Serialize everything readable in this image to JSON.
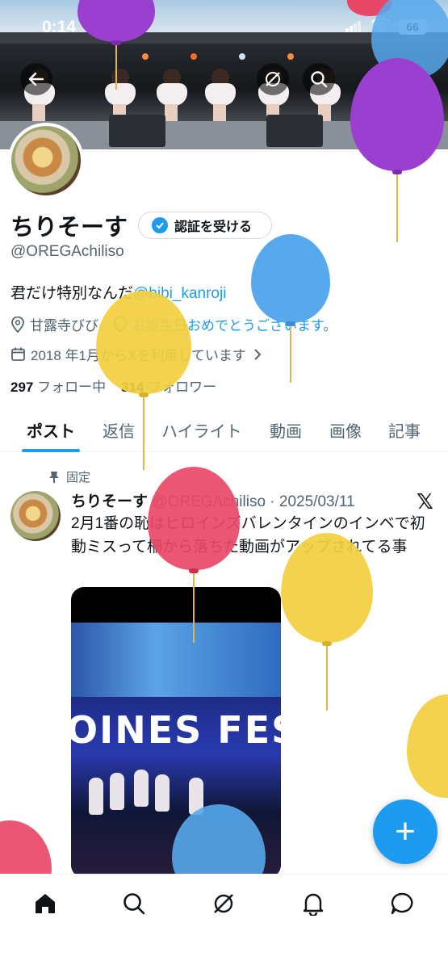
{
  "status_bar": {
    "time": "0:14",
    "battery": "66"
  },
  "profile": {
    "name": "ちりそーす",
    "verify_button": "認証を受ける",
    "handle": "@OREGAchiliso",
    "bio_prefix": "君だけ特別なんだ",
    "bio_mention": "@bibi_kanroji",
    "location": "甘露寺びび",
    "website": "お誕生日おめでとうございます。",
    "joined": "2018 年1月からXを利用しています",
    "following_count": "297",
    "following_label": "フォロー中",
    "followers_count": "314",
    "followers_label": "フォロワー"
  },
  "tabs": [
    "ポスト",
    "返信",
    "ハイライト",
    "動画",
    "画像",
    "記事"
  ],
  "post": {
    "pinned_label": "固定",
    "author": "ちりそーす",
    "handle_date": "@OREGAchiliso · 2025/03/11",
    "text": "2月1番の恥はヒロインズバレンタインのインベで初動ミスって柵から落ちた動画がアップされてる事",
    "media_banner": "OINES FES"
  },
  "fab_label": "+",
  "icons": {
    "back": "back-arrow-icon",
    "grok": "grok-icon",
    "search": "search-icon",
    "home": "home-icon",
    "notifications": "bell-icon",
    "messages": "message-icon",
    "pin": "pin-icon",
    "location": "location-pin-icon",
    "link": "link-icon",
    "calendar": "calendar-icon",
    "x": "x-logo-icon"
  },
  "colors": {
    "accent": "#1d9bf0",
    "text": "#0f1419",
    "secondary": "#536471",
    "balloon_purple": "#9b3fd0",
    "balloon_blue": "#57a8ec",
    "balloon_yellow": "#f2cf3f",
    "balloon_red": "#e84868"
  }
}
